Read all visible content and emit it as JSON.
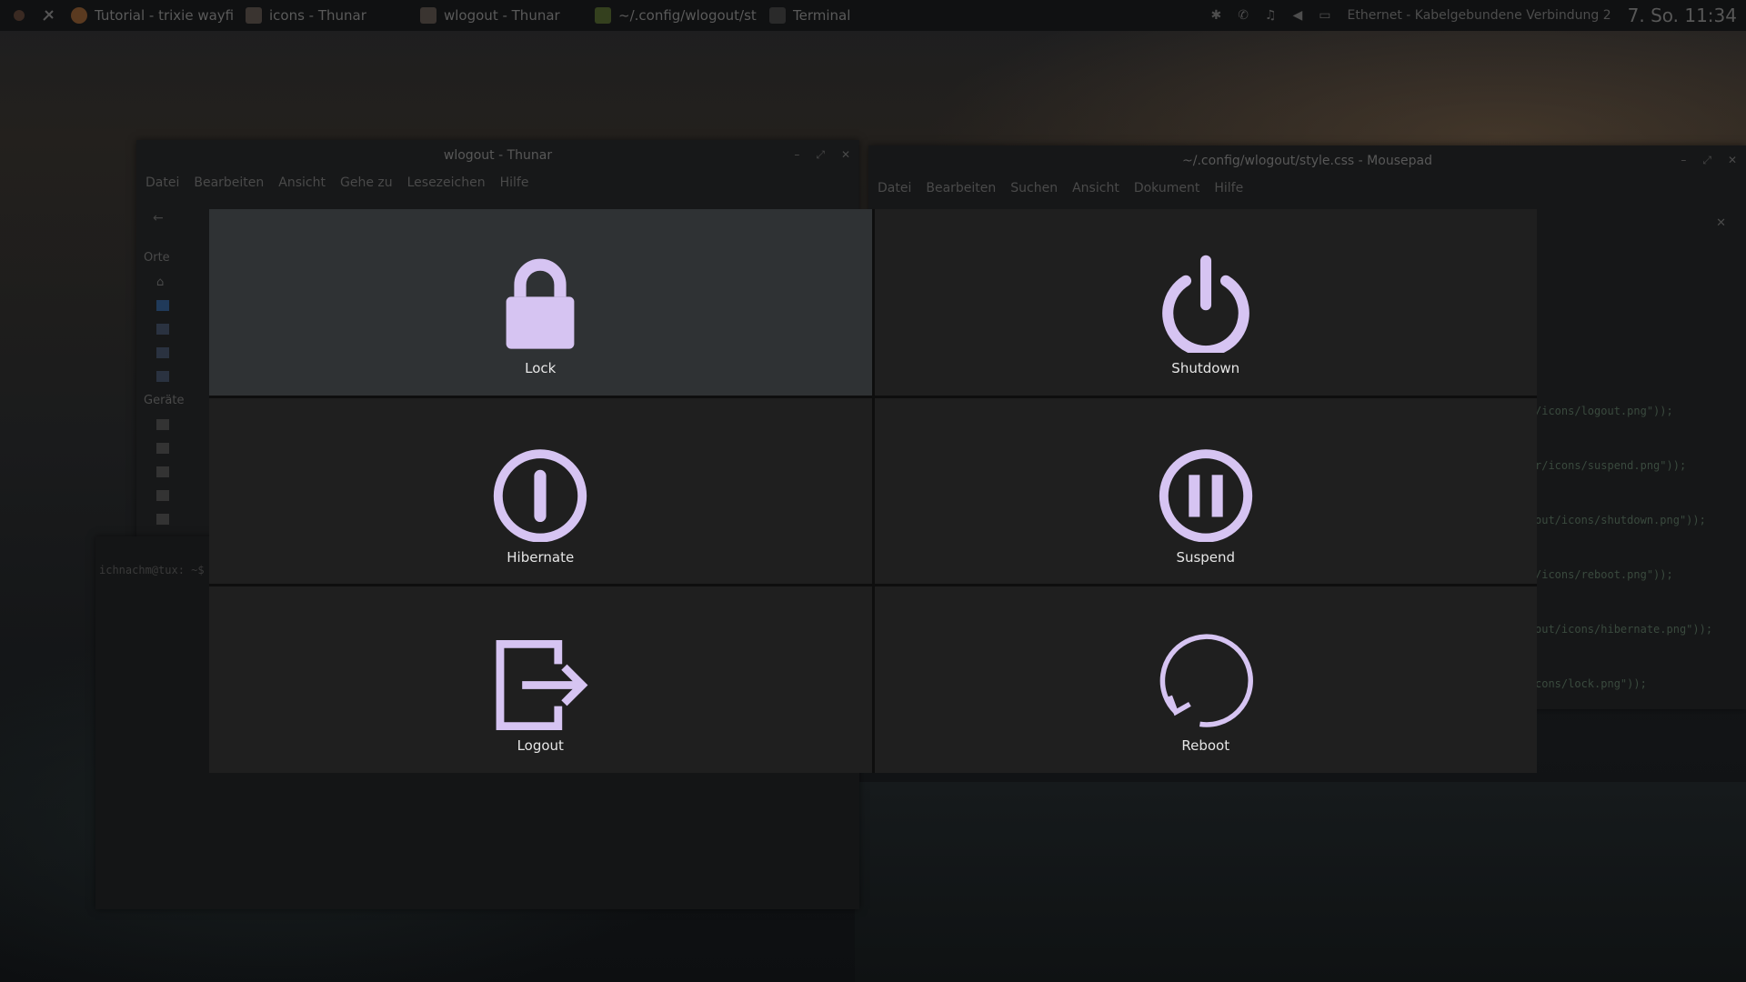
{
  "taskbar": {
    "tasks": [
      "Tutorial - trixie wayfir...",
      "icons - Thunar",
      "wlogout - Thunar",
      "~/.config/wlogout/st...",
      "Terminal"
    ],
    "network": "Ethernet - Kabelgebundene Verbindung 2",
    "clock": "7. So. 11:34"
  },
  "thunar": {
    "title": "wlogout - Thunar",
    "menu": [
      "Datei",
      "Bearbeiten",
      "Ansicht",
      "Gehe zu",
      "Lesezeichen",
      "Hilfe"
    ],
    "section_places": "Orte",
    "section_devices": "Geräte",
    "terminal_prompt": "ichnachm@tux: ~$"
  },
  "mousepad": {
    "title": "~/.config/wlogout/style.css - Mousepad",
    "menu": [
      "Datei",
      "Bearbeiten",
      "Suchen",
      "Ansicht",
      "Dokument",
      "Hilfe"
    ],
    "code_lines": [
      "/icons/logout.png\"));",
      "r/icons/suspend.png\"));",
      "out/icons/shutdown.png\"));",
      "/icons/reboot.png\"));",
      "out/icons/hibernate.png\"));",
      "cons/lock.png\"));"
    ]
  },
  "wlogout": {
    "accent": "#d6c4f2",
    "focus_bg": "#2f3234",
    "button_bg": "#1f1f1f",
    "buttons": [
      {
        "label": "Lock",
        "icon": "lock-icon"
      },
      {
        "label": "Shutdown",
        "icon": "power-icon"
      },
      {
        "label": "Hibernate",
        "icon": "hibernate-icon"
      },
      {
        "label": "Suspend",
        "icon": "pause-icon"
      },
      {
        "label": "Logout",
        "icon": "logout-icon"
      },
      {
        "label": "Reboot",
        "icon": "reboot-icon"
      }
    ]
  }
}
